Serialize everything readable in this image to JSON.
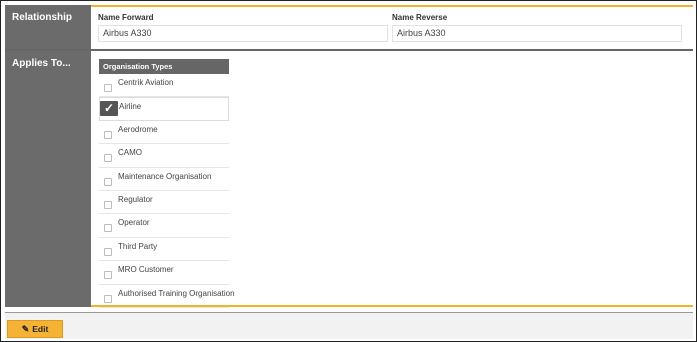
{
  "relationship": {
    "section_label": "Relationship",
    "name_forward_label": "Name Forward",
    "name_forward_value": "Airbus A330",
    "name_reverse_label": "Name Reverse",
    "name_reverse_value": "Airbus A330"
  },
  "applies_to": {
    "section_label": "Applies To...",
    "table_header": "Organisation Types",
    "items": [
      {
        "label": "Centrik Aviation",
        "checked": false
      },
      {
        "label": "Airline",
        "checked": true
      },
      {
        "label": "Aerodrome",
        "checked": false
      },
      {
        "label": "CAMO",
        "checked": false
      },
      {
        "label": "Maintenance Organisation",
        "checked": false
      },
      {
        "label": "Regulator",
        "checked": false
      },
      {
        "label": "Operator",
        "checked": false
      },
      {
        "label": "Third Party",
        "checked": false
      },
      {
        "label": "MRO Customer",
        "checked": false
      },
      {
        "label": "Authorised Training Organisation",
        "checked": false
      }
    ]
  },
  "footer": {
    "edit_label": "Edit",
    "edit_icon": "edit-icon"
  },
  "colors": {
    "accent": "#f0b429",
    "label_bg": "#6b6b6b",
    "button": "#f5b335"
  }
}
